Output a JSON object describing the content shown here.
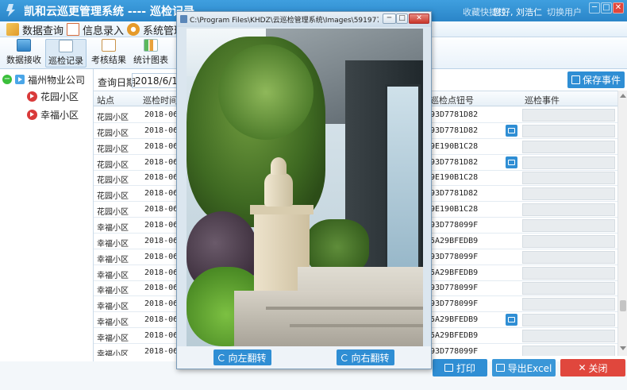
{
  "app": {
    "title": "凯和云巡更管理系统 ---- 巡检记录",
    "favorites": "收藏快捷栏",
    "greeting": "您好, 刘浩仁",
    "switch_user": "切换用户",
    "window_controls": {
      "minimize": "─",
      "maximize": "□",
      "close": "✕"
    }
  },
  "menu": [
    {
      "label": "数据查询",
      "icon": "data-query-icon"
    },
    {
      "label": "信息录入",
      "icon": "info-entry-icon"
    },
    {
      "label": "系统管理",
      "icon": "system-gear-icon"
    }
  ],
  "toolbar": [
    {
      "label": "数据接收",
      "icon": "monitor-icon",
      "active": false
    },
    {
      "label": "巡检记录",
      "icon": "chart-icon",
      "active": true
    },
    {
      "label": "考核结果",
      "icon": "assessment-icon",
      "active": false
    },
    {
      "label": "统计图表",
      "icon": "bar-chart-icon",
      "active": false
    }
  ],
  "tree": {
    "root": "福州物业公司",
    "children": [
      "花园小区",
      "幸福小区"
    ]
  },
  "query": {
    "label": "查询日期",
    "date": "2018/6/1 0:0"
  },
  "save_event_label": "保存事件",
  "grid": {
    "headers": {
      "site": "站点",
      "time": "巡检时间",
      "code": "巡检点钮号",
      "event": "巡检事件"
    },
    "rows": [
      {
        "site": "花园小区",
        "time": "2018-06-2",
        "code": "93D7781D82",
        "has_image": false
      },
      {
        "site": "花园小区",
        "time": "2018-06-2",
        "code": "93D7781D82",
        "has_image": true
      },
      {
        "site": "花园小区",
        "time": "2018-06-2",
        "code": "9E190B1C28",
        "has_image": false
      },
      {
        "site": "花园小区",
        "time": "2018-06-2",
        "code": "93D7781D82",
        "has_image": true
      },
      {
        "site": "花园小区",
        "time": "2018-06-2",
        "code": "9E190B1C28",
        "has_image": false
      },
      {
        "site": "花园小区",
        "time": "2018-06-2",
        "code": "93D7781D82",
        "has_image": false
      },
      {
        "site": "花园小区",
        "time": "2018-06-2",
        "code": "9E190B1C28",
        "has_image": false
      },
      {
        "site": "幸福小区",
        "time": "2018-06-2",
        "code": "93D778099F",
        "has_image": false
      },
      {
        "site": "幸福小区",
        "time": "2018-06-2",
        "code": "5A29BFEDB9",
        "has_image": false
      },
      {
        "site": "幸福小区",
        "time": "2018-06-2",
        "code": "93D778099F",
        "has_image": false
      },
      {
        "site": "幸福小区",
        "time": "2018-06-2",
        "code": "5A29BFEDB9",
        "has_image": false
      },
      {
        "site": "幸福小区",
        "time": "2018-06-2",
        "code": "93D778099F",
        "has_image": false
      },
      {
        "site": "幸福小区",
        "time": "2018-06-2",
        "code": "93D778099F",
        "has_image": false
      },
      {
        "site": "幸福小区",
        "time": "2018-06-2",
        "code": "5A29BFEDB9",
        "has_image": true
      },
      {
        "site": "幸福小区",
        "time": "2018-06-2",
        "code": "5A29BFEDB9",
        "has_image": false
      },
      {
        "site": "幸福小区",
        "time": "2018-06-2",
        "code": "93D778099F",
        "has_image": false
      },
      {
        "site": "幸福小区",
        "time": "2018-06-2",
        "code": "93D778099F",
        "has_image": false
      }
    ]
  },
  "footer": {
    "print": "打印",
    "export": "导出Excel",
    "close": "关闭"
  },
  "popup": {
    "title": "C:\\Program Files\\KHDZ\\云巡检管理系统\\Images\\59197736\\3482_20...",
    "rotate_left": "向左翻转",
    "rotate_right": "向右翻转",
    "window_controls": {
      "minimize": "─",
      "maximize": "□",
      "close": "✕"
    }
  },
  "colors": {
    "title_bar": "#2a85c8",
    "accent_button": "#2f8ed4",
    "export_button": "#3a97d8",
    "close_button": "#e0473d",
    "status_bar": "#3a97d8"
  }
}
